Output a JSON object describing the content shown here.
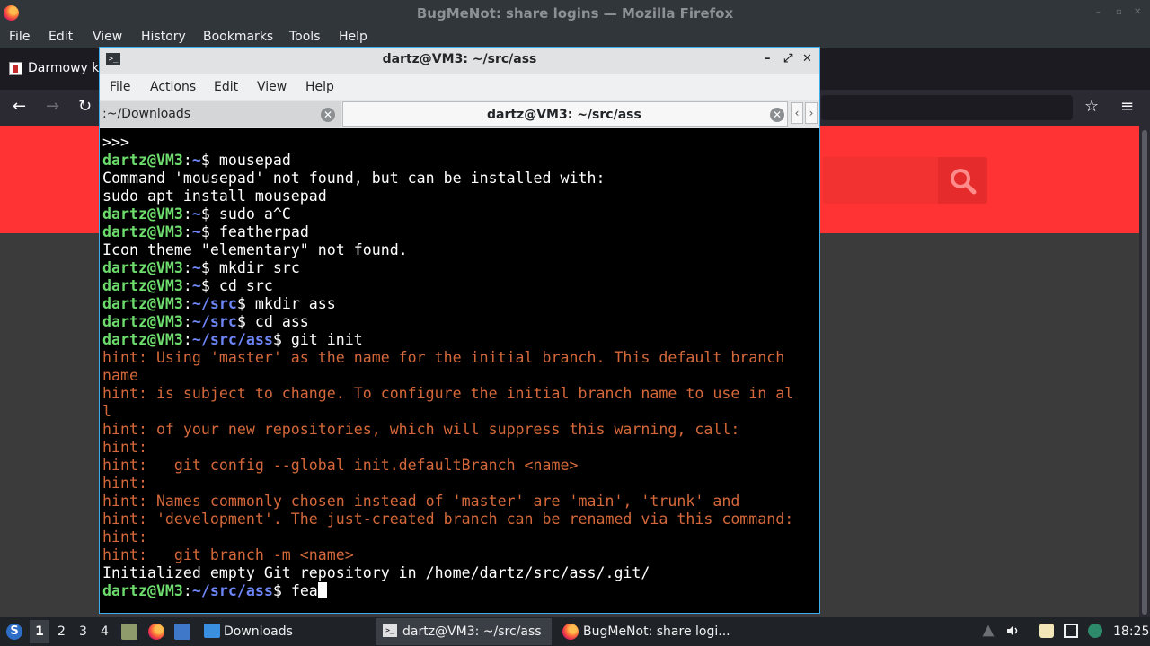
{
  "firefox": {
    "window_title": "BugMeNot: share logins — Mozilla Firefox",
    "menu": [
      "File",
      "Edit",
      "View",
      "History",
      "Bookmarks",
      "Tools",
      "Help"
    ],
    "tab_label": "Darmowy ka",
    "nav_icons": [
      "back-icon",
      "forward-icon",
      "reload-icon",
      "star-icon",
      "hamburger-menu-icon"
    ],
    "page_accent": "#ff3333"
  },
  "terminal": {
    "title": "dartz@VM3: ~/src/ass",
    "menu": [
      "File",
      "Actions",
      "Edit",
      "View",
      "Help"
    ],
    "tabs": [
      {
        "label": ":~/Downloads"
      },
      {
        "label": "dartz@VM3: ~/src/ass"
      }
    ],
    "lines": [
      {
        "spans": [
          {
            "t": ">>>",
            "c": ""
          }
        ]
      },
      {
        "spans": [
          {
            "t": "dartz@VM3",
            "c": "pu"
          },
          {
            "t": ":",
            "c": ""
          },
          {
            "t": "~",
            "c": "pp"
          },
          {
            "t": "$ mousepad",
            "c": ""
          }
        ]
      },
      {
        "spans": [
          {
            "t": "Command 'mousepad' not found, but can be installed with:",
            "c": ""
          }
        ]
      },
      {
        "spans": [
          {
            "t": "sudo apt install mousepad",
            "c": ""
          }
        ]
      },
      {
        "spans": [
          {
            "t": "dartz@VM3",
            "c": "pu"
          },
          {
            "t": ":",
            "c": ""
          },
          {
            "t": "~",
            "c": "pp"
          },
          {
            "t": "$ sudo a^C",
            "c": ""
          }
        ]
      },
      {
        "spans": [
          {
            "t": "dartz@VM3",
            "c": "pu"
          },
          {
            "t": ":",
            "c": ""
          },
          {
            "t": "~",
            "c": "pp"
          },
          {
            "t": "$ featherpad",
            "c": ""
          }
        ]
      },
      {
        "spans": [
          {
            "t": "Icon theme \"elementary\" not found.",
            "c": ""
          }
        ]
      },
      {
        "spans": [
          {
            "t": "dartz@VM3",
            "c": "pu"
          },
          {
            "t": ":",
            "c": ""
          },
          {
            "t": "~",
            "c": "pp"
          },
          {
            "t": "$ mkdir src",
            "c": ""
          }
        ]
      },
      {
        "spans": [
          {
            "t": "dartz@VM3",
            "c": "pu"
          },
          {
            "t": ":",
            "c": ""
          },
          {
            "t": "~",
            "c": "pp"
          },
          {
            "t": "$ cd src",
            "c": ""
          }
        ]
      },
      {
        "spans": [
          {
            "t": "dartz@VM3",
            "c": "pu"
          },
          {
            "t": ":",
            "c": ""
          },
          {
            "t": "~/src",
            "c": "pp"
          },
          {
            "t": "$ mkdir ass",
            "c": ""
          }
        ]
      },
      {
        "spans": [
          {
            "t": "dartz@VM3",
            "c": "pu"
          },
          {
            "t": ":",
            "c": ""
          },
          {
            "t": "~/src",
            "c": "pp"
          },
          {
            "t": "$ cd ass",
            "c": ""
          }
        ]
      },
      {
        "spans": [
          {
            "t": "dartz@VM3",
            "c": "pu"
          },
          {
            "t": ":",
            "c": ""
          },
          {
            "t": "~/src/ass",
            "c": "pp"
          },
          {
            "t": "$ git init",
            "c": ""
          }
        ]
      },
      {
        "spans": [
          {
            "t": "hint: Using 'master' as the name for the initial branch. This default branch",
            "c": "hint"
          }
        ]
      },
      {
        "spans": [
          {
            "t": "name",
            "c": "hint"
          }
        ]
      },
      {
        "spans": [
          {
            "t": "hint: is subject to change. To configure the initial branch name to use in al",
            "c": "hint"
          }
        ]
      },
      {
        "spans": [
          {
            "t": "l",
            "c": "hint"
          }
        ]
      },
      {
        "spans": [
          {
            "t": "hint: of your new repositories, which will suppress this warning, call:",
            "c": "hint"
          }
        ]
      },
      {
        "spans": [
          {
            "t": "hint:",
            "c": "hint"
          }
        ]
      },
      {
        "spans": [
          {
            "t": "hint:   git config --global init.defaultBranch <name>",
            "c": "hint"
          }
        ]
      },
      {
        "spans": [
          {
            "t": "hint:",
            "c": "hint"
          }
        ]
      },
      {
        "spans": [
          {
            "t": "hint: Names commonly chosen instead of 'master' are 'main', 'trunk' and",
            "c": "hint"
          }
        ]
      },
      {
        "spans": [
          {
            "t": "hint: 'development'. The just-created branch can be renamed via this command:",
            "c": "hint"
          }
        ]
      },
      {
        "spans": [
          {
            "t": "hint:",
            "c": "hint"
          }
        ]
      },
      {
        "spans": [
          {
            "t": "hint:   git branch -m <name>",
            "c": "hint"
          }
        ]
      },
      {
        "spans": [
          {
            "t": "Initialized empty Git repository in /home/dartz/src/ass/.git/",
            "c": ""
          }
        ]
      },
      {
        "spans": [
          {
            "t": "dartz@VM3",
            "c": "pu"
          },
          {
            "t": ":",
            "c": ""
          },
          {
            "t": "~/src/ass",
            "c": "pp"
          },
          {
            "t": "$ fea",
            "c": ""
          }
        ],
        "cursor": true
      }
    ],
    "colors": {
      "user_host": "#6ddc6d",
      "path": "#6d84f5",
      "hint": "#d4683a"
    }
  },
  "taskbar": {
    "workspaces": [
      "1",
      "2",
      "3",
      "4"
    ],
    "tasks": [
      "Downloads",
      "dartz@VM3: ~/src/ass",
      "BugMeNot: share logi..."
    ],
    "clock": "18:25"
  }
}
